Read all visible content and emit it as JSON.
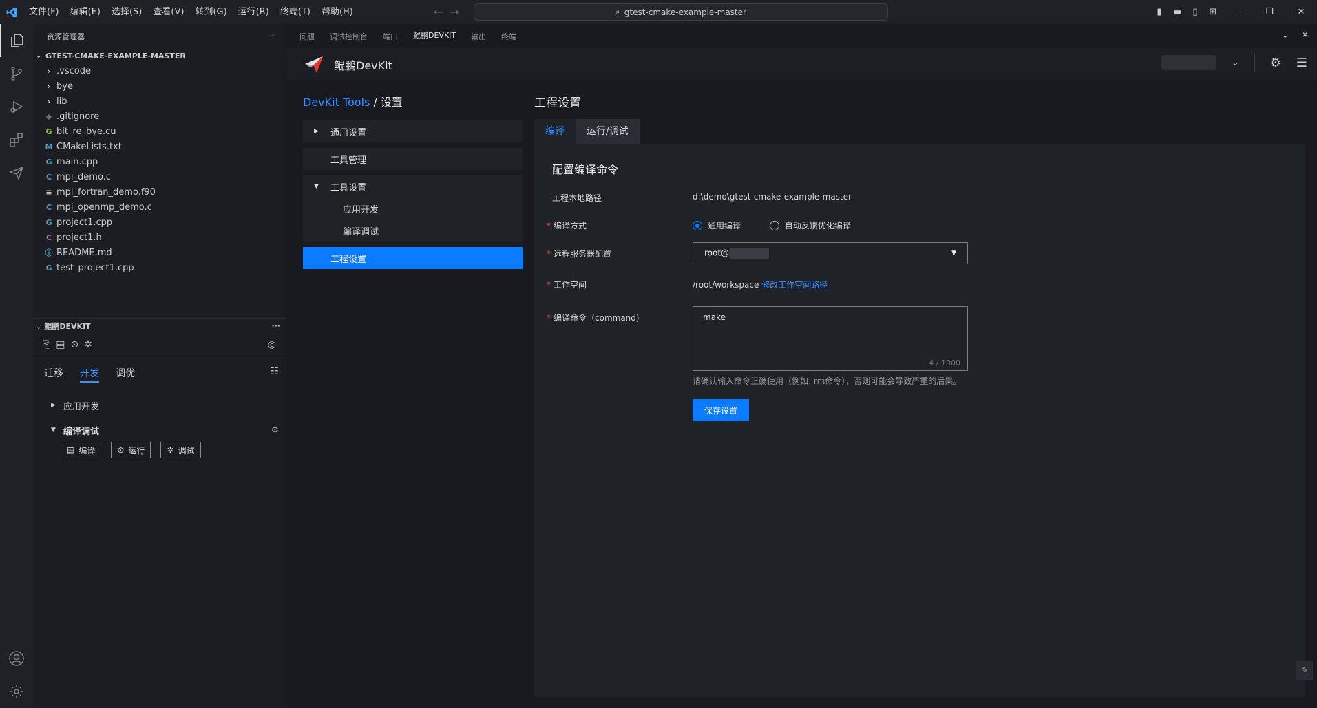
{
  "titlebar": {
    "menu": [
      "文件(F)",
      "编辑(E)",
      "选择(S)",
      "查看(V)",
      "转到(G)",
      "运行(R)",
      "终端(T)",
      "帮助(H)"
    ],
    "search_text": "gtest-cmake-example-master"
  },
  "sidebar": {
    "header": "资源管理器",
    "project_title": "GTEST-CMAKE-EXAMPLE-MASTER",
    "files": [
      {
        "name": ".vscode",
        "icon": "chevron-right-icon",
        "color": "#cccccc",
        "glyph": "›"
      },
      {
        "name": "bye",
        "icon": "chevron-right-icon",
        "color": "#cccccc",
        "glyph": "›"
      },
      {
        "name": "lib",
        "icon": "chevron-right-icon",
        "color": "#cccccc",
        "glyph": "›"
      },
      {
        "name": ".gitignore",
        "icon": "git-icon",
        "color": "#6d6d6d",
        "glyph": "◆"
      },
      {
        "name": "bit_re_bye.cu",
        "icon": "cuda-icon",
        "color": "#8bc34a",
        "glyph": "G"
      },
      {
        "name": "CMakeLists.txt",
        "icon": "cmake-icon",
        "color": "#519aba",
        "glyph": "M"
      },
      {
        "name": "main.cpp",
        "icon": "cpp-icon",
        "color": "#519aba",
        "glyph": "G"
      },
      {
        "name": "mpi_demo.c",
        "icon": "c-icon",
        "color": "#519aba",
        "glyph": "C"
      },
      {
        "name": "mpi_fortran_demo.f90",
        "icon": "fortran-icon",
        "color": "#cccccc",
        "glyph": "≡"
      },
      {
        "name": "mpi_openmp_demo.c",
        "icon": "c-icon",
        "color": "#519aba",
        "glyph": "C"
      },
      {
        "name": "project1.cpp",
        "icon": "cpp-icon",
        "color": "#519aba",
        "glyph": "G"
      },
      {
        "name": "project1.h",
        "icon": "header-icon",
        "color": "#a074c4",
        "glyph": "C"
      },
      {
        "name": "README.md",
        "icon": "info-icon",
        "color": "#519aba",
        "glyph": "ⓘ"
      },
      {
        "name": "test_project1.cpp",
        "icon": "cpp-icon",
        "color": "#519aba",
        "glyph": "G"
      }
    ],
    "devkit": {
      "section_title": "鲲鹏DEVKIT",
      "tabs": [
        "迁移",
        "开发",
        "调优"
      ],
      "active_tab": "开发",
      "tree": {
        "app_dev": "应用开发",
        "compile_debug": "编译调试"
      },
      "buttons": {
        "compile": "编译",
        "run": "运行",
        "debug": "调试"
      }
    }
  },
  "panel": {
    "tabs": [
      "问题",
      "调试控制台",
      "端口",
      "鲲鹏DEVKIT",
      "输出",
      "终端"
    ],
    "active_tab": "鲲鹏DEVKIT"
  },
  "devkit_header": {
    "title": "鲲鹏DevKit"
  },
  "settings_nav": {
    "breadcrumb_link": "DevKit Tools",
    "breadcrumb_sep": " / ",
    "breadcrumb_current": "设置",
    "general": "通用设置",
    "tool_mgmt": "工具管理",
    "tool_settings": "工具设置",
    "app_dev": "应用开发",
    "compile_debug": "编译调试",
    "project_settings": "工程设置"
  },
  "project": {
    "title": "工程设置",
    "tabs": {
      "compile": "编译",
      "run_debug": "运行/调试"
    },
    "section_title": "配置编译命令",
    "local_path_label": "工程本地路径",
    "local_path_value": "d:\\demo\\gtest-cmake-example-master",
    "compile_mode_label": "编译方式",
    "mode_general": "通用编译",
    "mode_feedback": "自动反馈优化编译",
    "remote_label": "远程服务器配置",
    "remote_value": "root@",
    "workspace_label": "工作空间",
    "workspace_value": "/root/workspace",
    "workspace_link": "修改工作空间路径",
    "command_label": "编译命令（command)",
    "command_value": "make",
    "command_count": "4 / 1000",
    "hint": "请确认输入命令正确使用（例如: rm命令），否则可能会导致严重的后果。",
    "save_button": "保存设置"
  },
  "colors": {
    "accent": "#0b7bff",
    "link": "#3a90ff",
    "required": "#ff4d4f"
  }
}
